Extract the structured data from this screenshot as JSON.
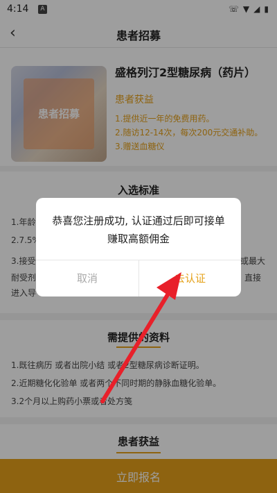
{
  "status_bar": {
    "time": "4:14",
    "notification_icon": "A"
  },
  "header": {
    "title": "患者招募",
    "back_icon": "chevron-left"
  },
  "drug": {
    "name": "盛格列汀2型糖尿病（药片）",
    "thumbnail_label": "患者招募",
    "benefit_title": "患者获益",
    "benefits": [
      "1.提供近一年的免费用药。",
      "2.随访12-14次，每次200元交通补助。",
      "3.赠送血糖仪"
    ]
  },
  "criteria": {
    "title": "入选标准",
    "visible_lines": [
      "1.年龄",
      "2.7.5%",
      "3.接受",
      "耐受剂",
      "进入导",
      "或最大",
      "直接"
    ]
  },
  "materials": {
    "title": "需提供的资料",
    "items": [
      "1.既往病历 或者出院小结 或者2型糖尿病诊断证明。",
      "2.近期糖化化验单 或者两个不同时期的静脉血糖化验单。",
      "3.2个月以上购药小票或者处方笺"
    ]
  },
  "section_benefits": {
    "title": "患者获益"
  },
  "bottom_button": {
    "label": "立即报名"
  },
  "dialog": {
    "message": "恭喜您注册成功, 认证通过后即可接单赚取高额佣金",
    "cancel_label": "取消",
    "confirm_label": "去认证"
  },
  "colors": {
    "accent": "#e5a11a",
    "annotation_arrow": "#e8202a"
  }
}
